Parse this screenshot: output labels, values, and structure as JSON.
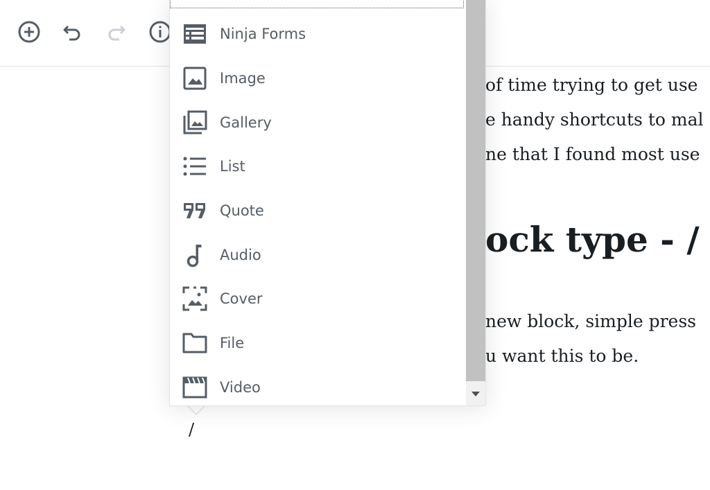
{
  "toolbar": {
    "buttons": [
      {
        "name": "add-block-button",
        "icon": "plus-circle-icon"
      },
      {
        "name": "undo-button",
        "icon": "undo-icon"
      },
      {
        "name": "redo-button",
        "icon": "redo-icon",
        "disabled": true
      },
      {
        "name": "info-button",
        "icon": "info-icon"
      }
    ]
  },
  "content": {
    "paragraph1": [
      "of time trying to get use",
      "e handy shortcuts to mal",
      "ne that I found most use"
    ],
    "heading": "ock type - /",
    "paragraph2": [
      "new block, simple press",
      "u want this to be."
    ],
    "slash_input": "/"
  },
  "block_menu": {
    "items": [
      {
        "label": "Ninja Forms",
        "icon": "form-icon"
      },
      {
        "label": "Image",
        "icon": "image-icon"
      },
      {
        "label": "Gallery",
        "icon": "gallery-icon"
      },
      {
        "label": "List",
        "icon": "list-icon"
      },
      {
        "label": "Quote",
        "icon": "quote-icon"
      },
      {
        "label": "Audio",
        "icon": "music-note-icon"
      },
      {
        "label": "Cover",
        "icon": "cover-image-icon"
      },
      {
        "label": "File",
        "icon": "folder-icon"
      },
      {
        "label": "Video",
        "icon": "video-clapper-icon"
      }
    ]
  },
  "colors": {
    "text": "#191e23",
    "icon": "#555d66",
    "icon_disabled": "#ccd0d4",
    "border": "#e2e4e7",
    "scroll_thumb": "#c1c1c1",
    "scroll_track": "#f1f1f1"
  }
}
